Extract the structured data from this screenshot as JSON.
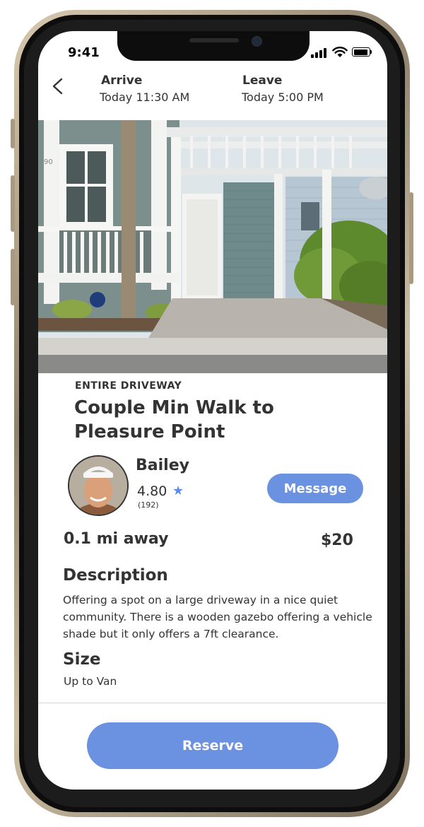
{
  "status_bar": {
    "time": "9:41"
  },
  "header": {
    "arrive_label": "Arrive",
    "arrive_value": "Today 11:30 AM",
    "leave_label": "Leave",
    "leave_value": "Today 5:00 PM"
  },
  "photo": {
    "house_number": "90"
  },
  "listing": {
    "category": "ENTIRE DRIVEWAY",
    "title": "Couple Min Walk to Pleasure Point",
    "distance": "0.1 mi away",
    "price": "$20"
  },
  "host": {
    "name": "Bailey",
    "rating": "4.80",
    "review_count": "(192)",
    "message_label": "Message"
  },
  "description": {
    "title": "Description",
    "body": "Offering a spot on a large driveway in a nice quiet community. There is a wooden gazebo offering a vehicle shade but it only offers a 7ft clearance."
  },
  "size": {
    "title": "Size",
    "value": "Up to Van"
  },
  "footer": {
    "reserve_label": "Reserve"
  },
  "colors": {
    "accent": "#6b92e0",
    "text": "#333333"
  },
  "icons": [
    "back-chevron-icon",
    "signal-icon",
    "wifi-icon",
    "battery-icon",
    "star-icon"
  ]
}
